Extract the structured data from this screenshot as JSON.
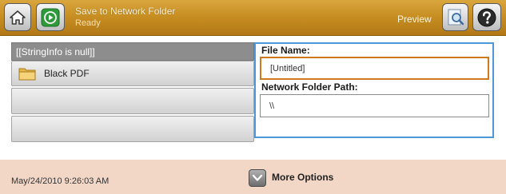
{
  "header": {
    "title": "Save to Network Folder",
    "status": "Ready",
    "preview_label": "Preview"
  },
  "icons": {
    "home": "home-icon",
    "start": "start-icon",
    "preview": "magnifier-icon",
    "help": "help-icon",
    "folder": "folder-icon",
    "more_options": "chevron-down-icon"
  },
  "list": {
    "header": "[[StringInfo is null]]",
    "items": [
      {
        "label": "Black PDF"
      },
      {
        "label": ""
      },
      {
        "label": ""
      }
    ]
  },
  "form": {
    "file_name_label": "File Name:",
    "file_name_value": "[Untitled]",
    "path_label": "Network Folder Path:",
    "path_value": "\\\\"
  },
  "footer": {
    "datetime": "May/24/2010 9:26:03 AM",
    "more_options_label": "More Options"
  },
  "colors": {
    "titlebar": "#c88f23",
    "panel_border": "#4f97d6",
    "active_input_border": "#d07a1e",
    "footer": "#f2d7c7",
    "start_green": "#2f9a3a"
  }
}
